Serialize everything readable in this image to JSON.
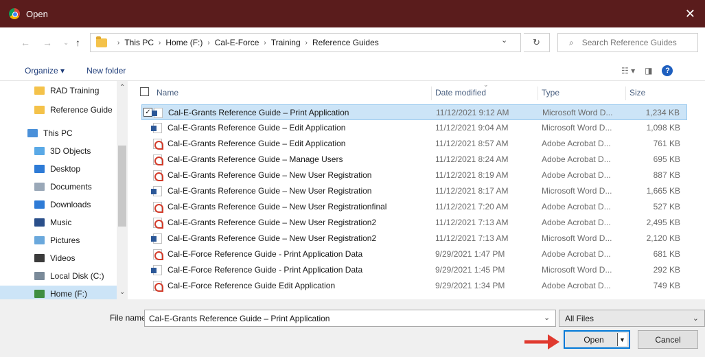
{
  "window": {
    "title": "Open"
  },
  "address": {
    "crumbs": [
      "This PC",
      "Home (F:)",
      "Cal-E-Force",
      "Training",
      "Reference Guides"
    ],
    "search_placeholder": "Search Reference Guides"
  },
  "toolbar": {
    "organize": "Organize ▾",
    "new_folder": "New folder"
  },
  "nav": {
    "items": [
      {
        "label": "RAD Training",
        "icon": "folder-icon"
      },
      {
        "label": "Reference Guide",
        "icon": "folder-icon"
      },
      {
        "label": "This PC",
        "icon": "computer-icon"
      },
      {
        "label": "3D Objects",
        "icon": "cube-icon"
      },
      {
        "label": "Desktop",
        "icon": "desktop-icon"
      },
      {
        "label": "Documents",
        "icon": "document-icon"
      },
      {
        "label": "Downloads",
        "icon": "download-icon"
      },
      {
        "label": "Music",
        "icon": "music-icon"
      },
      {
        "label": "Pictures",
        "icon": "picture-icon"
      },
      {
        "label": "Videos",
        "icon": "video-icon"
      },
      {
        "label": "Local Disk (C:)",
        "icon": "disk-icon"
      },
      {
        "label": "Home (F:)",
        "icon": "drive-icon"
      }
    ]
  },
  "columns": {
    "name": "Name",
    "date": "Date modified",
    "type": "Type",
    "size": "Size"
  },
  "files": [
    {
      "name": "Cal-E-Grants Reference Guide – Print Application",
      "date": "11/12/2021 9:12 AM",
      "type": "Microsoft Word D...",
      "size": "1,234 KB",
      "kind": "word"
    },
    {
      "name": "Cal-E-Grants Reference Guide – Edit Application",
      "date": "11/12/2021 9:04 AM",
      "type": "Microsoft Word D...",
      "size": "1,098 KB",
      "kind": "word"
    },
    {
      "name": "Cal-E-Grants Reference Guide – Edit Application",
      "date": "11/12/2021 8:57 AM",
      "type": "Adobe Acrobat D...",
      "size": "761 KB",
      "kind": "pdf"
    },
    {
      "name": "Cal-E-Grants Reference Guide – Manage Users",
      "date": "11/12/2021 8:24 AM",
      "type": "Adobe Acrobat D...",
      "size": "695 KB",
      "kind": "pdf"
    },
    {
      "name": "Cal-E-Grants Reference Guide – New User Registration",
      "date": "11/12/2021 8:19 AM",
      "type": "Adobe Acrobat D...",
      "size": "887 KB",
      "kind": "pdf"
    },
    {
      "name": "Cal-E-Grants Reference Guide – New User Registration",
      "date": "11/12/2021 8:17 AM",
      "type": "Microsoft Word D...",
      "size": "1,665 KB",
      "kind": "word"
    },
    {
      "name": "Cal-E-Grants Reference Guide – New User Registrationfinal",
      "date": "11/12/2021 7:20 AM",
      "type": "Adobe Acrobat D...",
      "size": "527 KB",
      "kind": "pdf"
    },
    {
      "name": "Cal-E-Grants Reference Guide – New User Registration2",
      "date": "11/12/2021 7:13 AM",
      "type": "Adobe Acrobat D...",
      "size": "2,495 KB",
      "kind": "pdf"
    },
    {
      "name": "Cal-E-Grants Reference Guide – New User Registration2",
      "date": "11/12/2021 7:13 AM",
      "type": "Microsoft Word D...",
      "size": "2,120 KB",
      "kind": "word"
    },
    {
      "name": "Cal-E-Force Reference Guide -  Print Application Data",
      "date": "9/29/2021 1:47 PM",
      "type": "Adobe Acrobat D...",
      "size": "681 KB",
      "kind": "pdf"
    },
    {
      "name": "Cal-E-Force Reference Guide -  Print Application Data",
      "date": "9/29/2021 1:45 PM",
      "type": "Microsoft Word D...",
      "size": "292 KB",
      "kind": "word"
    },
    {
      "name": "Cal-E-Force Reference Guide  Edit Application",
      "date": "9/29/2021 1:34 PM",
      "type": "Adobe Acrobat D...",
      "size": "749 KB",
      "kind": "pdf"
    }
  ],
  "bottom": {
    "file_name_label": "File name:",
    "file_name_value": "Cal-E-Grants Reference Guide – Print Application",
    "filter": "All Files",
    "open": "Open",
    "cancel": "Cancel"
  },
  "colors": {
    "titlebar": "#5a1c1c",
    "selection": "#cce4f7",
    "accent": "#0078d7",
    "arrow": "#e03a2f"
  }
}
